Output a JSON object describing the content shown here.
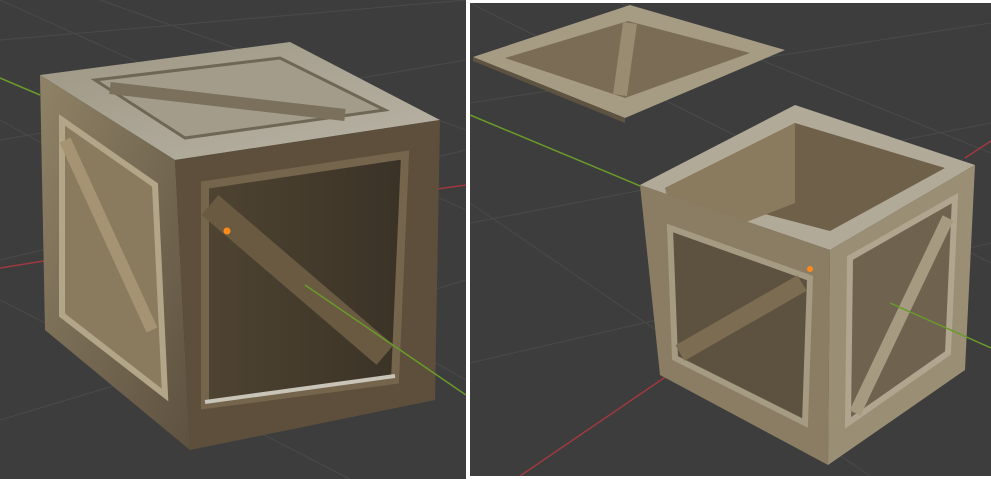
{
  "viewports": [
    {
      "name": "closed-crate-view",
      "object": "crate"
    },
    {
      "name": "open-crate-view",
      "object": "crate-with-lid"
    }
  ],
  "colors": {
    "background": "#3d3d3d",
    "grid": "#4a4a4a",
    "x_axis": "#a0393f",
    "y_axis": "#6a9a2a",
    "origin": "#ff8a1a",
    "wood_light": "#b8ac90",
    "wood_mid": "#7d6c52",
    "wood_dark": "#4b3f2f"
  }
}
